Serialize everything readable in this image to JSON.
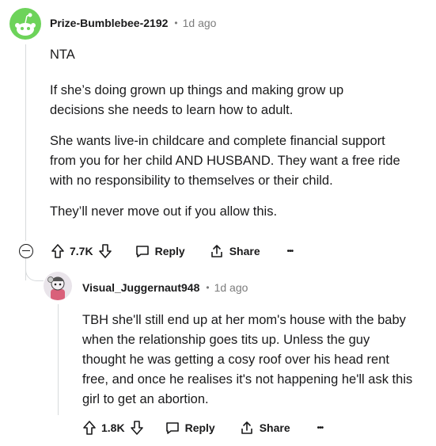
{
  "comment1": {
    "author": "Prize-Bumblebee-2192",
    "separator": "•",
    "time": "1d ago",
    "paragraphs": [
      "NTA",
      "If she’s doing grown up things and making grow up decisions she needs to learn how to adult.",
      "She wants live-in childcare and complete financial support from you for her child AND HUSBAND. They want a free ride with no responsibility to themselves or their child.",
      "They’ll never move out if you allow this."
    ],
    "votes": "7.7K",
    "reply_label": "Reply",
    "share_label": "Share",
    "more_label": "•••"
  },
  "comment2": {
    "author": "Visual_Juggernaut948",
    "separator": "•",
    "time": "1d ago",
    "paragraphs": [
      "TBH she'll still end up at her mom's house with the baby when the relationship goes tits up. Unless the guy thought he was getting a cosy roof over his head rent free, and once he realises it's not happening he'll ask this girl to get an abortion."
    ],
    "votes": "1.8K",
    "reply_label": "Reply",
    "share_label": "Share",
    "more_label": "•••"
  },
  "colors": {
    "text": "#1a1a1b",
    "meta": "#7c7c7c",
    "line": "#d7dadc",
    "avatar1": "#6dd35a"
  }
}
